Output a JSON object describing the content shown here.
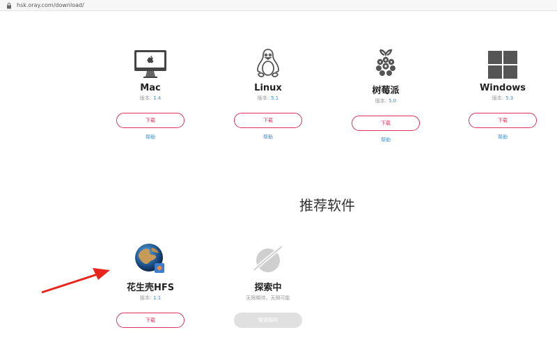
{
  "browser": {
    "url": "hsk.oray.com/download/"
  },
  "downloads": [
    {
      "name": "Mac",
      "version_label": "版本:",
      "version": "1.4",
      "download_label": "下载",
      "help_label": "帮助",
      "icon": "imac-icon"
    },
    {
      "name": "Linux",
      "version_label": "版本:",
      "version": "5.1",
      "download_label": "下载",
      "help_label": "帮助",
      "icon": "tux-penguin-icon"
    },
    {
      "name": "树莓派",
      "version_label": "版本:",
      "version": "5.0",
      "download_label": "下载",
      "help_label": "帮助",
      "icon": "raspberry-pi-icon"
    },
    {
      "name": "Windows",
      "version_label": "版本:",
      "version": "5.3",
      "download_label": "下载",
      "help_label": "帮助",
      "icon": "windows-logo-icon"
    }
  ],
  "recommended": {
    "title": "推荐软件",
    "items": [
      {
        "name": "花生壳HFS",
        "version_label": "版本:",
        "version": "1.1",
        "download_label": "下载",
        "icon": "globe-icon"
      },
      {
        "name": "探索中",
        "subtitle": "无限期待，无限可能",
        "button_label": "敬请期待",
        "icon": "planet-icon"
      }
    ]
  },
  "colors": {
    "accent": "#e0305a",
    "link": "#3c8cdc",
    "annotation_arrow": "#e8241c"
  }
}
